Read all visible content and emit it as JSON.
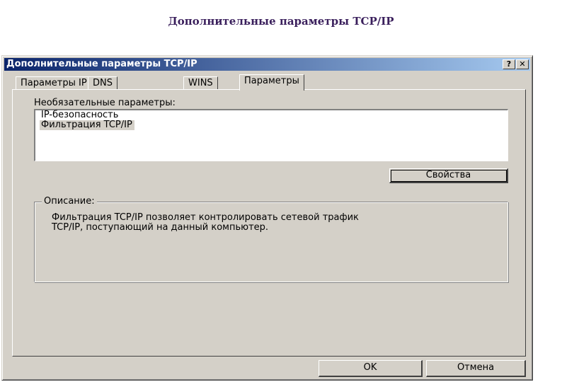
{
  "page": {
    "caption": "Дополнительные параметры TCP/IP"
  },
  "window": {
    "title": "Дополнительные параметры TCP/IP",
    "help_button": "?",
    "close_button": "✕"
  },
  "tabs": [
    {
      "label": "Параметры IP",
      "active": false
    },
    {
      "label": "DNS",
      "active": false
    },
    {
      "label": "WINS",
      "active": false
    },
    {
      "label": "Параметры",
      "active": true
    }
  ],
  "optional_settings": {
    "label": "Необязательные параметры:",
    "items": [
      {
        "label": "IP-безопасность",
        "selected": false
      },
      {
        "label": "Фильтрация TCP/IP",
        "selected": true
      }
    ],
    "properties_button": "Свойства"
  },
  "description": {
    "title": "Описание:",
    "text": "Фильтрация TCP/IP позволяет контролировать сетевой трафик\nTCP/IP,  поступающий на данный компьютер."
  },
  "footer": {
    "ok_button": "OK",
    "cancel_button": "Отмена"
  },
  "colors": {
    "face": "#d4d0c8",
    "title_start": "#0a246a",
    "title_end": "#a6caf0",
    "caption": "#3a1f5c"
  }
}
